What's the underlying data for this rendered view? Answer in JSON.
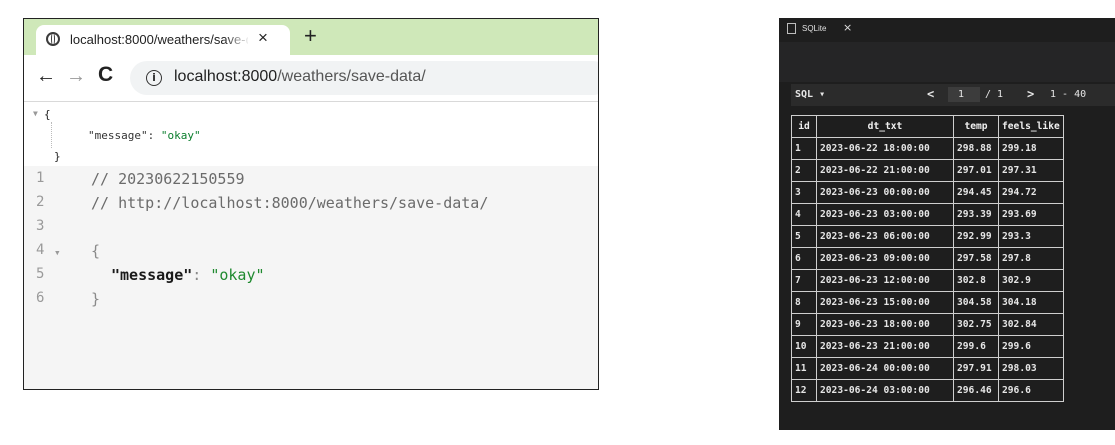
{
  "browser": {
    "tab_title": "localhost:8000/weathers/save-da",
    "tab_close": "×",
    "new_tab": "+",
    "nav": {
      "back": "←",
      "forward": "→",
      "reload": "C"
    },
    "info_icon": "i",
    "url_host": "localhost:8000",
    "url_path": "/weathers/save-data/",
    "json_tree": {
      "toggle": "▼",
      "open": "{",
      "key": "\"message\":",
      "value": "\"okay\"",
      "close": "}"
    },
    "code_lines": [
      {
        "num": "1",
        "text": "// 20230622150559",
        "kind": "comment"
      },
      {
        "num": "2",
        "text": "// http://localhost:8000/weathers/save-data/",
        "kind": "comment"
      },
      {
        "num": "3",
        "text": "",
        "kind": "blank"
      },
      {
        "num": "4",
        "text": "{",
        "kind": "punc",
        "fold": "▾"
      },
      {
        "num": "5",
        "key": "\"message\"",
        "sep": ": ",
        "value": "\"okay\"",
        "kind": "pair"
      },
      {
        "num": "6",
        "text": "}",
        "kind": "punc"
      }
    ]
  },
  "sqlite": {
    "tab_title": "SQLite",
    "tab_close": "×",
    "toolbar": {
      "sql_button": "SQL ▾",
      "prev": "<",
      "page_value": "1",
      "total": "/ 1",
      "next": ">",
      "range": "1 - 40"
    },
    "columns": [
      "id",
      "dt_txt",
      "temp",
      "feels_like"
    ],
    "rows": [
      [
        "1",
        "2023-06-22 18:00:00",
        "298.88",
        "299.18"
      ],
      [
        "2",
        "2023-06-22 21:00:00",
        "297.01",
        "297.31"
      ],
      [
        "3",
        "2023-06-23 00:00:00",
        "294.45",
        "294.72"
      ],
      [
        "4",
        "2023-06-23 03:00:00",
        "293.39",
        "293.69"
      ],
      [
        "5",
        "2023-06-23 06:00:00",
        "292.99",
        "293.3"
      ],
      [
        "6",
        "2023-06-23 09:00:00",
        "297.58",
        "297.8"
      ],
      [
        "7",
        "2023-06-23 12:00:00",
        "302.8",
        "302.9"
      ],
      [
        "8",
        "2023-06-23 15:00:00",
        "304.58",
        "304.18"
      ],
      [
        "9",
        "2023-06-23 18:00:00",
        "302.75",
        "302.84"
      ],
      [
        "10",
        "2023-06-23 21:00:00",
        "299.6",
        "299.6"
      ],
      [
        "11",
        "2023-06-24 00:00:00",
        "297.91",
        "298.03"
      ],
      [
        "12",
        "2023-06-24 03:00:00",
        "296.46",
        "296.6"
      ]
    ]
  }
}
